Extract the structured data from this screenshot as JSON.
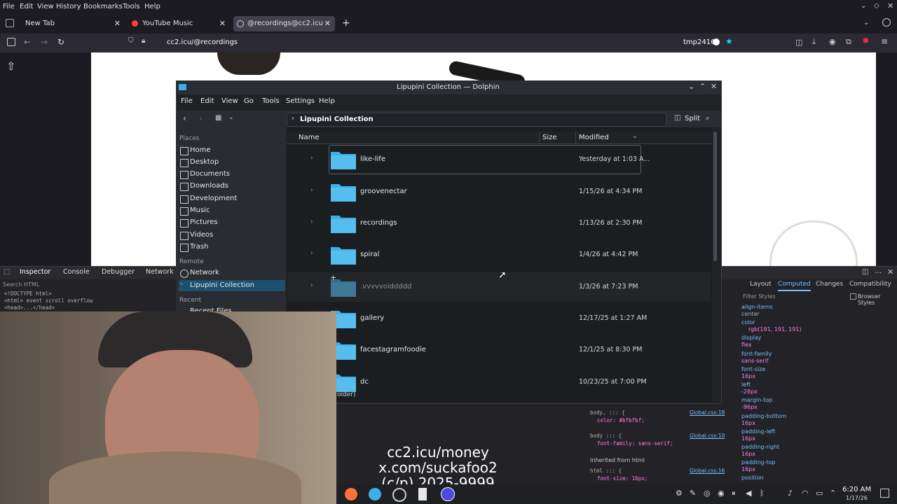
{
  "browser": {
    "menu": [
      "File",
      "Edit",
      "View",
      "History",
      "Bookmarks",
      "Tools",
      "Help"
    ],
    "tabs": [
      {
        "title": "New Tab"
      },
      {
        "title": "YouTube Music"
      },
      {
        "title": "@recordings@cc2.icu"
      }
    ],
    "url": "cc2.icu/@recordings",
    "profile_label": "tmp2416"
  },
  "devtools": {
    "tabs": [
      "Inspector",
      "Console",
      "Debugger",
      "Network"
    ],
    "search_placeholder": "Search HTML",
    "html_lines": [
      "<!DOCTYPE html>",
      "<html> event scroll overflow",
      "<head>...</head>"
    ],
    "right_tabs": [
      "Layout",
      "Computed",
      "Changes",
      "Compatibility"
    ],
    "filter_placeholder": "Filter Styles",
    "browser_styles_label": "Browser Styles",
    "computed": [
      {
        "prop": "align-items",
        "val": "center"
      },
      {
        "prop": "color",
        "val": "rgb(191, 191, 191)"
      },
      {
        "prop": "display",
        "val": "flex"
      },
      {
        "prop": "font-family",
        "val": "sans-serif"
      },
      {
        "prop": "font-size",
        "val": "16px"
      },
      {
        "prop": "left",
        "val": "-28px"
      },
      {
        "prop": "margin-top",
        "val": "-96px"
      },
      {
        "prop": "padding-bottom",
        "val": "16px"
      },
      {
        "prop": "padding-left",
        "val": "16px"
      },
      {
        "prop": "padding-right",
        "val": "16px"
      },
      {
        "prop": "padding-top",
        "val": "16px"
      },
      {
        "prop": "position",
        "val": ""
      }
    ],
    "rules": [
      {
        "sel": "body, ::: {",
        "decl": "color: #bfbfbf;",
        "src": "Global.css:18"
      },
      {
        "sel": "body ::: {",
        "decl": "font-family: sans-serif;",
        "src": "Global.css:10"
      },
      {
        "sel": "html ::: {",
        "decl": "font-size: 16px;",
        "src": "Global.css:16"
      }
    ],
    "inherited_label": "Inherited from html"
  },
  "dolphin": {
    "title": "Lipupini Collection — Dolphin",
    "menu": [
      "File",
      "Edit",
      "View",
      "Go",
      "Tools",
      "Settings",
      "Help"
    ],
    "breadcrumb": "Lipupini Collection",
    "split_label": "Split",
    "places_header": "Places",
    "places": [
      "Home",
      "Desktop",
      "Documents",
      "Downloads",
      "Development",
      "Music",
      "Pictures",
      "Videos",
      "Trash"
    ],
    "remote_header": "Remote",
    "remote": [
      "Network",
      "Lipupini Collection"
    ],
    "recent_header": "Recent",
    "recent": [
      "Recent Files"
    ],
    "columns": {
      "name": "Name",
      "size": "Size",
      "modified": "Modified"
    },
    "rows": [
      {
        "name": "like-life",
        "modified": "Yesterday at 1:03 A...",
        "expandable": true,
        "hidden": false
      },
      {
        "name": "groovenectar",
        "modified": "1/15/26 at 4:34 PM",
        "expandable": true,
        "hidden": false
      },
      {
        "name": "recordings",
        "modified": "1/13/26 at 2:30 PM",
        "expandable": true,
        "hidden": false
      },
      {
        "name": "spiral",
        "modified": "1/4/26 at 4:42 PM",
        "expandable": true,
        "hidden": false
      },
      {
        "name": ".vvvvvoiddddd",
        "modified": "1/3/26 at 7:23 PM",
        "expandable": true,
        "hidden": true
      },
      {
        "name": "gallery",
        "modified": "12/17/25 at 1:27 AM",
        "expandable": false,
        "hidden": false
      },
      {
        "name": "facestagramfoodie",
        "modified": "12/1/25 at 8:30 PM",
        "expandable": false,
        "hidden": false
      },
      {
        "name": "dc",
        "modified": "10/23/25 at 7:00 PM",
        "expandable": false,
        "hidden": false
      }
    ],
    "status_fragment": "older)"
  },
  "overlay": {
    "line1": "cc2.icu/money",
    "line2": "x.com/suckafoo2",
    "line3": "(c/p) 2025-9999"
  },
  "taskbar": {
    "time": "6:20 AM",
    "date": "1/17/26"
  },
  "colors": {
    "folder": "#3daee9",
    "accent": "#3daee9",
    "selection": "#1f4f6e"
  }
}
